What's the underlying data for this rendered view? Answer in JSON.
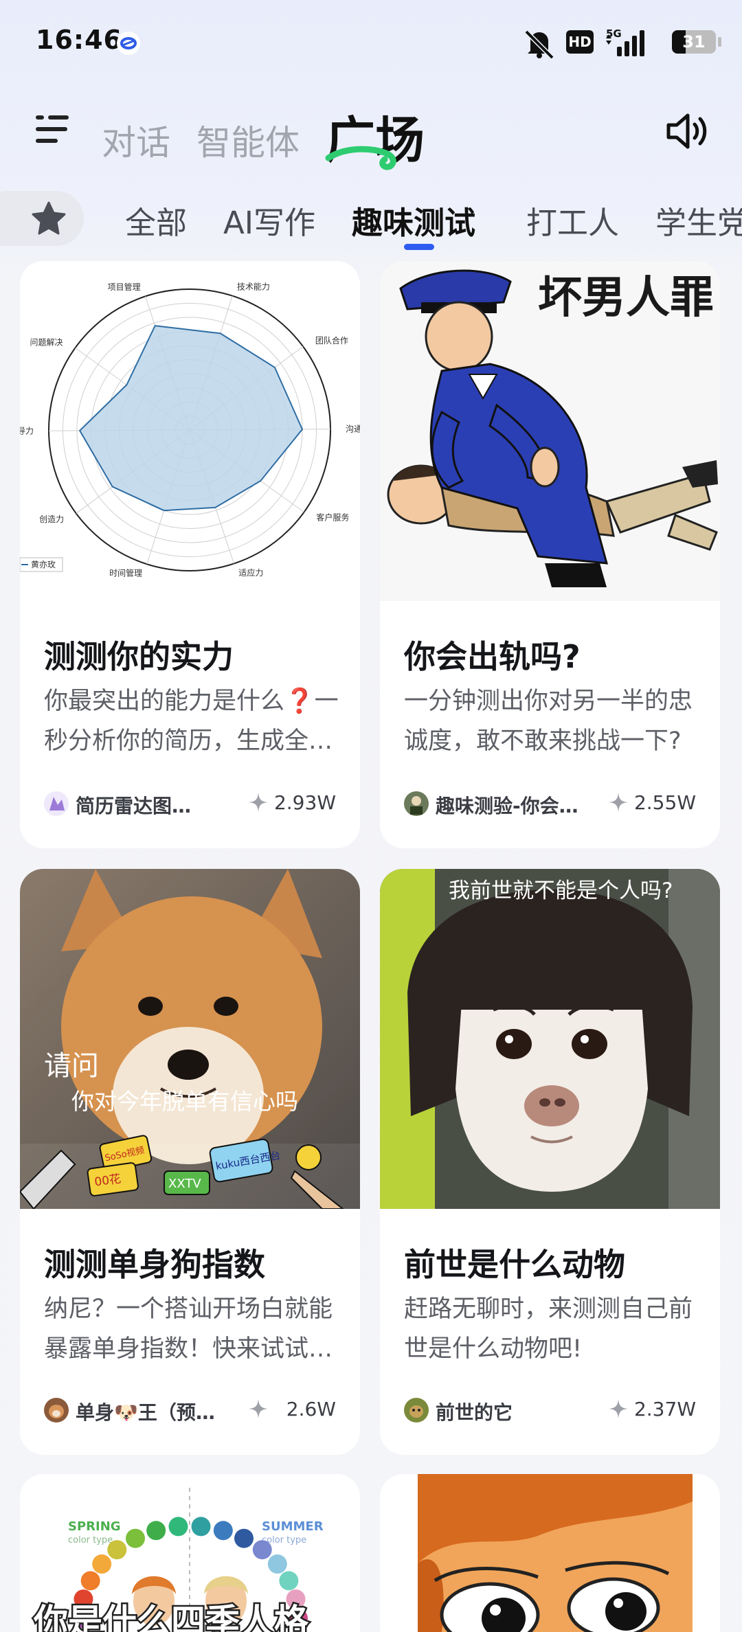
{
  "status_bar": {
    "time": "16:46",
    "network": "5G",
    "hd": "HD",
    "battery": "31"
  },
  "header": {
    "tabs": [
      {
        "label": "对话",
        "active": false
      },
      {
        "label": "智能体",
        "active": false
      },
      {
        "label": "广场",
        "active": true
      }
    ]
  },
  "categories": [
    "全部",
    "AI写作",
    "趣味测试",
    "打工人",
    "学生党"
  ],
  "active_category": "趣味测试",
  "colors": {
    "accent": "#2e5cf0",
    "active_stroke": "#2ecc71"
  },
  "radar_labels": [
    "项目管理",
    "技术能力",
    "团队合作",
    "沟通",
    "客户服务",
    "适应力",
    "时间管理",
    "创造力",
    "领导力",
    "问题解决"
  ],
  "radar_values": [
    0.78,
    0.72,
    0.75,
    0.8,
    0.62,
    0.58,
    0.6,
    0.68,
    0.78,
    0.55
  ],
  "radar_legend": "黄亦玫",
  "cards": [
    {
      "title": "测测你的实力",
      "desc": "你最突出的能力是什么❓一秒分析你的简历，生成全…",
      "author": "简历雷达图…",
      "count": "2.93W",
      "image": {
        "kind": "radar-chart"
      }
    },
    {
      "title": "你会出轨吗?",
      "desc": "一分钟测出你对另一半的忠诚度，敢不敢来挑战一下?",
      "author": "趣味测验-你会…",
      "count": "2.55W",
      "image": {
        "kind": "cartoon-police",
        "caption": "坏男人罪"
      }
    },
    {
      "title": "测测单身狗指数",
      "desc": "纳尼？一个搭讪开场白就能暴露单身指数！快来试试…",
      "author": "单身🐶王（预…",
      "count": "2.6W",
      "image": {
        "kind": "dog-photo",
        "caption1": "请问",
        "caption2": "你对今年脱单有信心吗",
        "mics": [
          "SoSo视频",
          "00花",
          "XXTV",
          "kuku西台西台"
        ]
      }
    },
    {
      "title": "前世是什么动物",
      "desc": "赶路无聊时，来测测自己前世是什么动物吧!",
      "author": "前世的它",
      "count": "2.37W",
      "image": {
        "kind": "dog-wig-photo",
        "caption": "我前世就不能是个人吗?"
      }
    },
    {
      "image": {
        "kind": "season-colors",
        "label_left": "SPRING",
        "sub_left": "color type",
        "label_right": "SUMMER",
        "sub_right": "color type",
        "caption": "你是什么四季人格"
      }
    },
    {
      "image": {
        "kind": "cartoon-face"
      }
    }
  ]
}
